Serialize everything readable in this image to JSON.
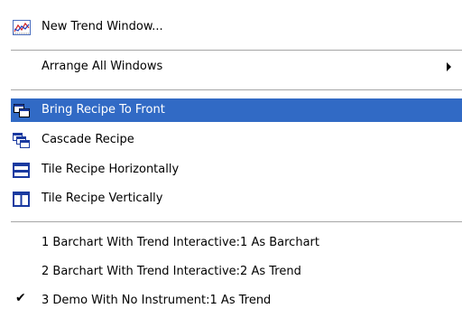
{
  "menu": {
    "items": {
      "new_trend_window": "New Trend Window...",
      "arrange_all_windows": "Arrange All Windows",
      "bring_recipe_to_front": "Bring Recipe To Front",
      "cascade_recipe": "Cascade Recipe",
      "tile_recipe_horizontally": "Tile Recipe Horizontally",
      "tile_recipe_vertically": "Tile Recipe Vertically",
      "window_1": "1 Barchart With Trend Interactive:1 As Barchart",
      "window_2": "2 Barchart With Trend Interactive:2 As Trend",
      "window_3": "3 Demo With No Instrument:1 As Trend"
    },
    "checked_item": "window_3",
    "selected_item": "bring_recipe_to_front",
    "colors": {
      "highlight": "#316ac5",
      "icon_blue": "#1a3aa0",
      "separator": "#a6a6a6"
    }
  }
}
